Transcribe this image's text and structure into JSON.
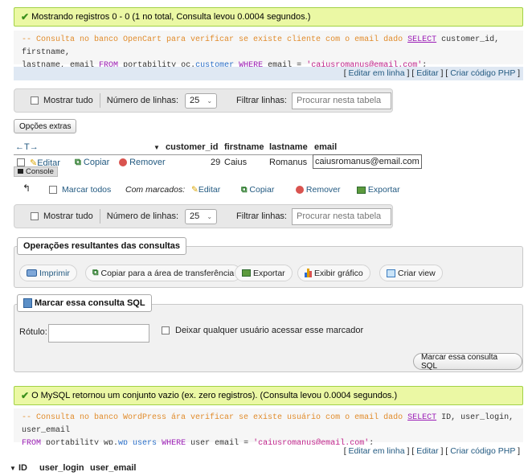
{
  "result1": {
    "success": "Mostrando registros 0 - 0 (1 no total, Consulta levou 0.0004 segundos.)",
    "sql_line1_comment": "-- Consulta no banco OpenCart para verificar se existe cliente com o email dado",
    "sql_select": "SELECT",
    "sql_line1_rest": "customer_id, firstname,",
    "sql_line2_cols": "lastname, email",
    "sql_from": "FROM",
    "sql_db": "portability_oc.",
    "sql_table": "customer",
    "sql_where": "WHERE",
    "sql_col": "email",
    "sql_eq": "=",
    "sql_value": "'caiusromanus@email.com'",
    "sql_end": ";",
    "links": {
      "inline": "Editar em linha",
      "edit": "Editar",
      "php": "Criar código PHP"
    }
  },
  "nav": {
    "show_all": "Mostrar tudo",
    "rows_label": "Número de linhas:",
    "rows_value": "25",
    "filter_label": "Filtrar linhas:",
    "filter_placeholder": "Procurar nesta tabela"
  },
  "extra_options": "Opções extras",
  "table1": {
    "arrows": "←T→",
    "headers": [
      "customer_id",
      "firstname",
      "lastname",
      "email"
    ],
    "row": {
      "edit": "Editar",
      "copy": "Copiar",
      "remove": "Remover",
      "customer_id": "29",
      "firstname": "Caius",
      "lastname": "Romanus",
      "email": "caiusromanus@email.com"
    }
  },
  "console": "Console",
  "bulk": {
    "mark_all": "Marcar todos",
    "with_marked": "Com marcados:",
    "edit": "Editar",
    "copy": "Copiar",
    "remove": "Remover",
    "export": "Exportar"
  },
  "query_ops": {
    "legend": "Operações resultantes das consultas",
    "print": "Imprimir",
    "copy_clip": "Copiar para a área de transferência",
    "export": "Exportar",
    "chart": "Exibir gráfico",
    "view": "Criar view"
  },
  "bookmark": {
    "legend": "Marcar essa consulta SQL",
    "label": "Rótulo:",
    "share": "Deixar qualquer usuário acessar esse marcador",
    "button": "Marcar essa consulta SQL"
  },
  "result2": {
    "success": "O MySQL retornou um conjunto vazio (ex. zero registros). (Consulta levou 0.0004 segundos.)",
    "sql_comment": "-- Consulta no banco WordPress ára verificar se existe usuário com o email dado",
    "sql_select": "SELECT",
    "sql_line1_rest": "ID, user_login, user_email",
    "sql_from": "FROM",
    "sql_db": "portability_wp.",
    "sql_table": "wp_users",
    "sql_where": "WHERE",
    "sql_col": "user_email",
    "sql_eq": "=",
    "sql_value": "'caiusromanus@email.com'",
    "sql_end": ";",
    "links": {
      "inline": "Editar em linha",
      "edit": "Editar",
      "php": "Criar código PHP"
    },
    "headers": [
      "ID",
      "user_login",
      "user_email"
    ]
  },
  "colors": {
    "success_bg": "#ebf8a4",
    "link": "#235a81",
    "keyword": "#9a1bb5",
    "comment": "#e18c2c"
  }
}
